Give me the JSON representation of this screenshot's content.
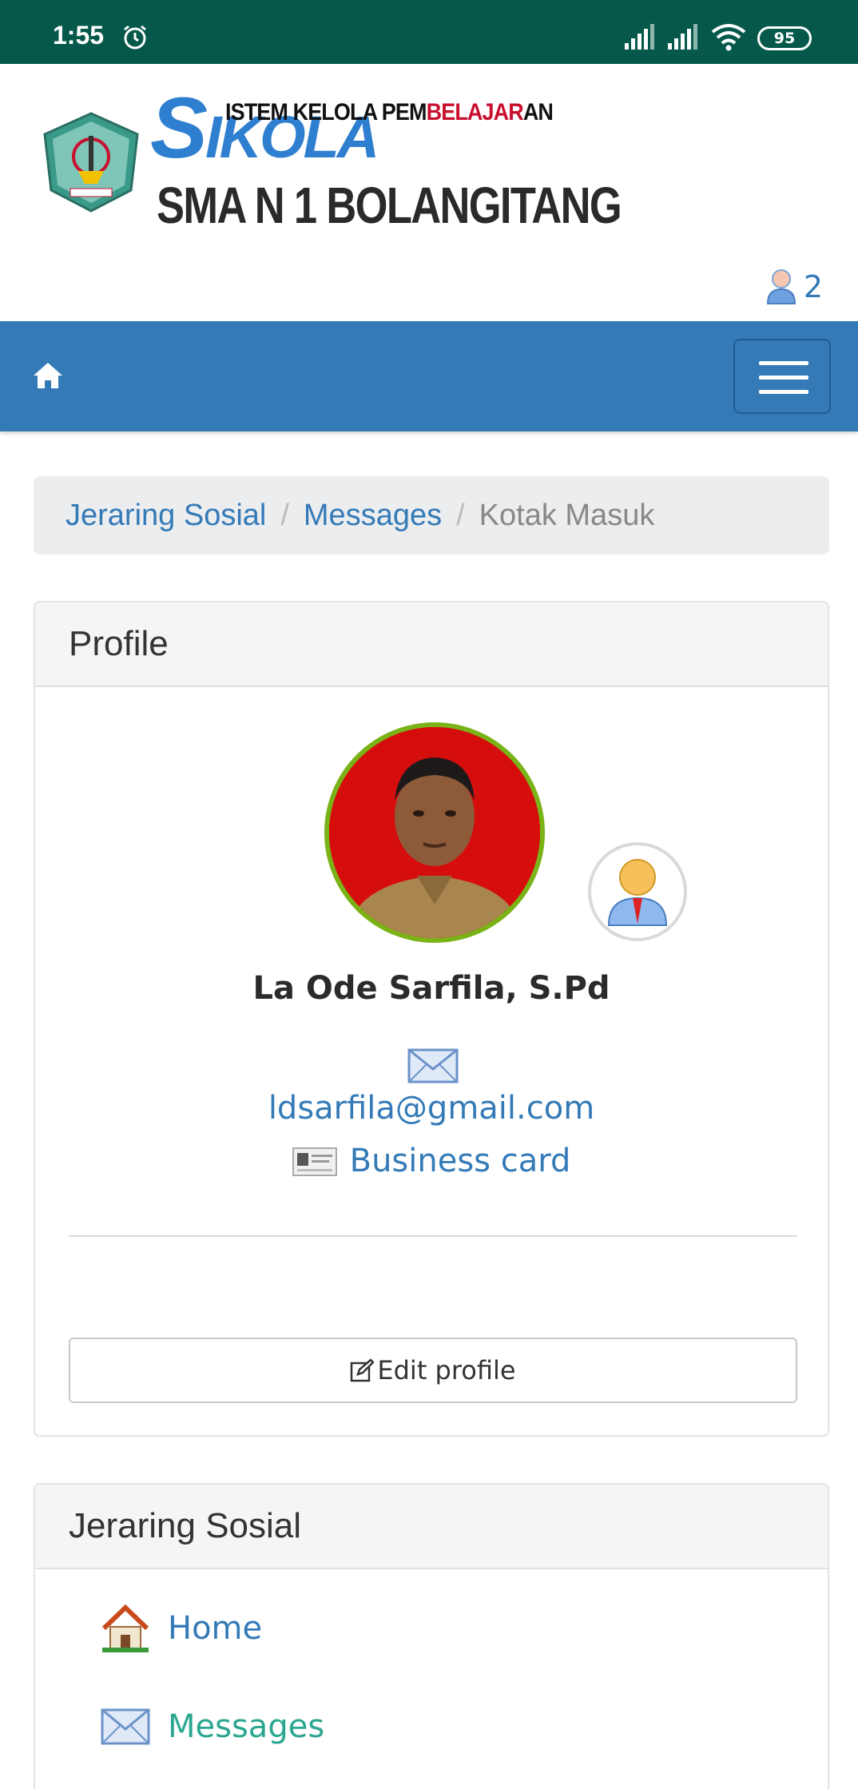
{
  "status_bar": {
    "time": "1:55",
    "battery": "95"
  },
  "header": {
    "logo": {
      "sub_black_1": "ISTEM KELOLA PEM",
      "sub_red": "BELAJAR",
      "sub_black_2": "AN",
      "big_s": "S",
      "big_rest": "IKOLA",
      "school": "SMA N 1 BOLANGITANG"
    },
    "online_users_count": "2"
  },
  "breadcrumb": {
    "items": [
      "Jeraring Sosial",
      "Messages"
    ],
    "active": "Kotak Masuk",
    "separator": "/"
  },
  "profile_panel": {
    "title": "Profile",
    "name": "La Ode Sarfila, S.Pd",
    "email": "ldsarfila@gmail.com",
    "business_card_label": "Business card",
    "edit_button_label": "Edit profile"
  },
  "social_panel": {
    "title": "Jeraring Sosial",
    "items": [
      "Home",
      "Messages"
    ]
  },
  "colors": {
    "status_bar": "#05584a",
    "navbar": "#337ab7",
    "link": "#337ab7",
    "avatar_border": "#7ab317"
  }
}
